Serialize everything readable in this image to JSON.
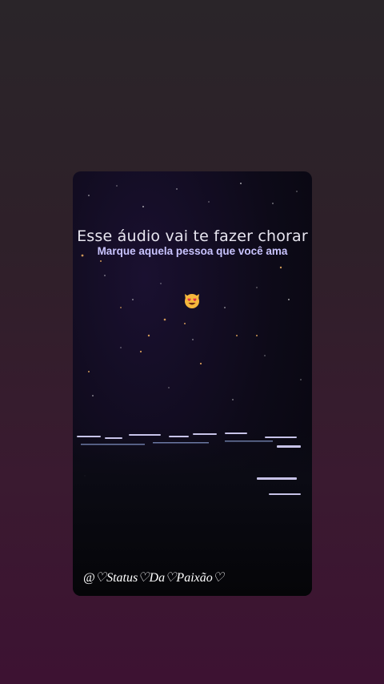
{
  "story": {
    "headline": "Esse áudio vai te fazer chorar",
    "subheadline": "Marque aquela pessoa que você ama",
    "emoji": "smiling-cat-heart-eyes",
    "handle": "@♡Status♡Da♡Paixão♡"
  },
  "colors": {
    "background_top": "#2a2529",
    "background_bottom": "#3d1232",
    "subheadline": "#c9c4ff"
  }
}
